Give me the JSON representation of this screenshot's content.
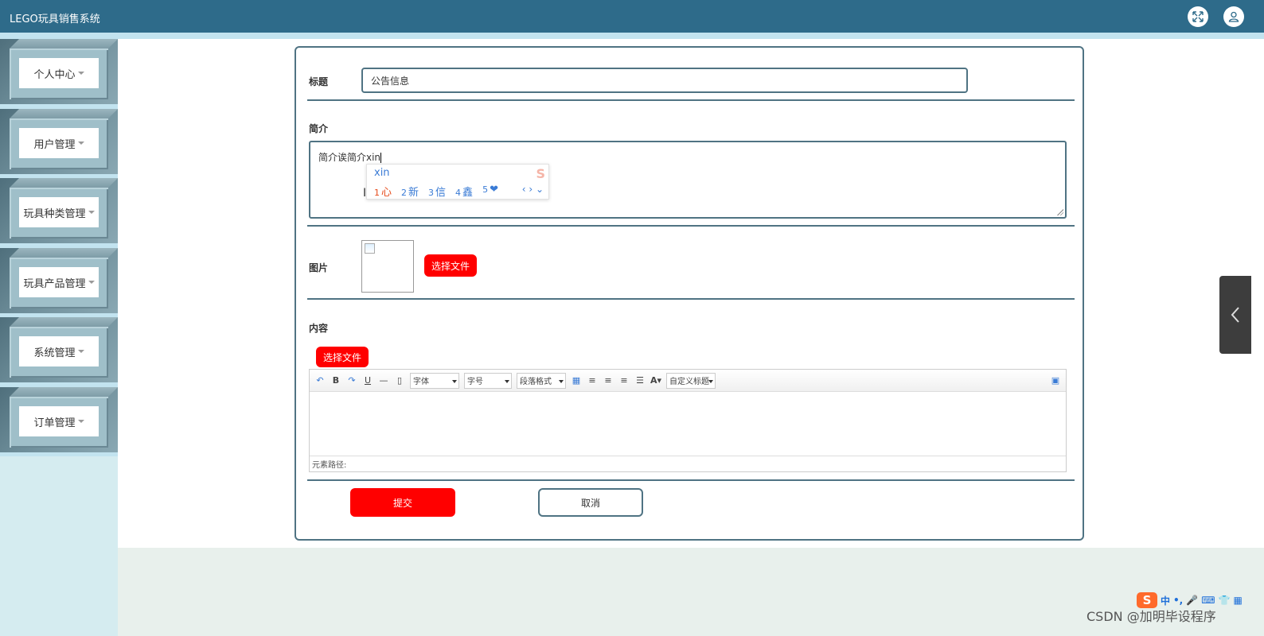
{
  "header": {
    "app_title": "LEGO玩具销售系统",
    "fullscreen_icon": "expand-icon",
    "user_icon": "user-icon"
  },
  "sidebar": {
    "items": [
      {
        "label": "个人中心"
      },
      {
        "label": "用户管理"
      },
      {
        "label": "玩具种类管理"
      },
      {
        "label": "玩具产品管理"
      },
      {
        "label": "系统管理"
      },
      {
        "label": "订单管理"
      }
    ]
  },
  "form": {
    "title_label": "标题",
    "title_value": "公告信息",
    "intro_label": "简介",
    "intro_value": "简介诶简介xin",
    "image_label": "图片",
    "image_button": "选择文件",
    "content_label": "内容",
    "content_button": "选择文件",
    "submit_label": "提交",
    "cancel_label": "取消"
  },
  "ime_popup": {
    "pinyin": "xin",
    "candidates": [
      {
        "num": "1",
        "text": "心"
      },
      {
        "num": "2",
        "text": "新"
      },
      {
        "num": "3",
        "text": "信"
      },
      {
        "num": "4",
        "text": "鑫"
      },
      {
        "num": "5",
        "text": "❤"
      }
    ],
    "nav": "‹ › ⌄"
  },
  "editor": {
    "font_family": "字体",
    "font_size": "字号",
    "paragraph": "段落格式",
    "custom_title": "自定义标题",
    "status_path": "元素路径:"
  },
  "tray": {
    "logo": "S",
    "lang": "中"
  },
  "watermark": "CSDN @加明毕设程序"
}
